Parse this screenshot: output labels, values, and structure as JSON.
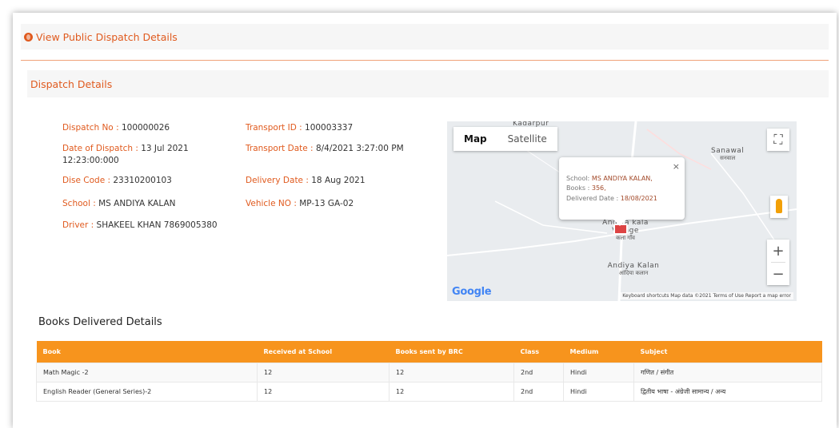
{
  "header": {
    "title": "View Public Dispatch Details"
  },
  "section": {
    "title": "Dispatch Details"
  },
  "details": {
    "dispatch_no": {
      "label": "Dispatch No :",
      "value": "100000026"
    },
    "date_of_dispatch": {
      "label": "Date of Dispatch :",
      "value": "13 Jul 2021 12:23:00:000"
    },
    "dise_code": {
      "label": "Dise Code :",
      "value": "23310200103"
    },
    "school": {
      "label": "School :",
      "value": "MS ANDIYA KALAN"
    },
    "driver": {
      "label": "Driver :",
      "value": "SHAKEEL KHAN 7869005380"
    },
    "transport_id": {
      "label": "Transport ID :",
      "value": "100003337"
    },
    "transport_date": {
      "label": "Transport Date :",
      "value": "8/4/2021 3:27:00 PM"
    },
    "delivery_date": {
      "label": "Delivery Date :",
      "value": "18 Aug 2021"
    },
    "vehicle_no": {
      "label": "Vehicle NO :",
      "value": "MP-13 GA-02"
    }
  },
  "map": {
    "tab_map": "Map",
    "tab_satellite": "Satellite",
    "info": {
      "school_label": "School:",
      "school_value": "MS ANDIYA KALAN,",
      "books_label": "Books :",
      "books_value": "356,",
      "delivered_label": "Delivered Date :",
      "delivered_value": "18/08/2021",
      "close": "×"
    },
    "places": {
      "kadarpur": "Kadarpur",
      "sanawal": "Sanawal",
      "sanawal_hi": "सनवाल",
      "andiya_kala_village": "Andiya kala Village",
      "andiya_kala_village_hi": "कला गाँव",
      "andiya_kalan": "Andiya Kalan",
      "andiya_kalan_hi": "आंदिया कलान"
    },
    "logo": "Google",
    "attribution": "Keyboard shortcuts   Map data ©2021   Terms of Use   Report a map error",
    "zoom_in": "+",
    "zoom_out": "−"
  },
  "books": {
    "title": "Books Delivered Details",
    "columns": [
      "Book",
      "Received at School",
      "Books sent by BRC",
      "Class",
      "Medium",
      "Subject"
    ],
    "rows": [
      [
        "Math Magic -2",
        "12",
        "12",
        "2nd",
        "Hindi",
        "गणित / संगीत"
      ],
      [
        "English Reader (General Series)-2",
        "12",
        "12",
        "2nd",
        "Hindi",
        "द्वितीय भाषा - अंग्रेजी सामान्य / अन्य"
      ]
    ]
  },
  "colors": {
    "accent": "#e05a1e",
    "table_header": "#f7941d"
  }
}
